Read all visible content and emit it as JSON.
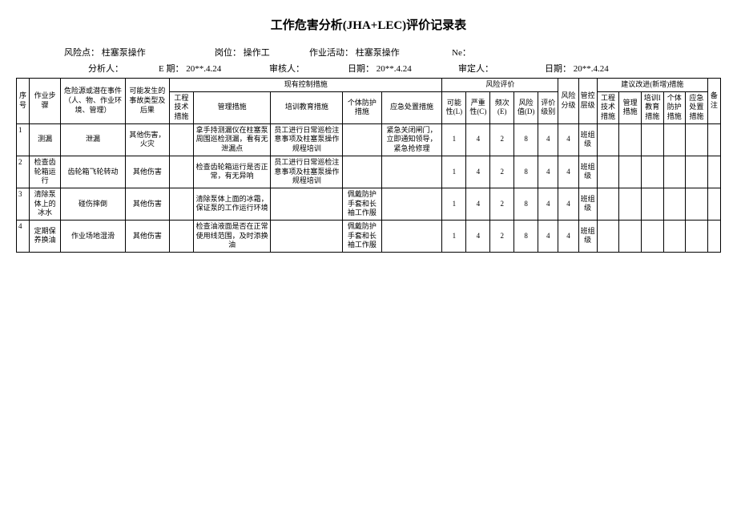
{
  "title": "工作危害分析(JHA+LEC)评价记录表",
  "meta": {
    "risk_point_label": "风险点：",
    "risk_point": "柱塞泵操作",
    "post_label": "岗位：",
    "post": "操作工",
    "activity_label": "作业活动：",
    "activity": "柱塞泵操作",
    "ne_label": "Ne：",
    "ne": "",
    "analyst_label": "分析人：",
    "analyst": "",
    "date_e_label": "E 期：",
    "date_e": "20**.4.24",
    "reviewer_label": "审核人：",
    "reviewer": "",
    "date1_label": "日期：",
    "date1": "20**.4.24",
    "approver_label": "审定人：",
    "approver": "",
    "date2_label": "日期：",
    "date2": "20**.4.24"
  },
  "headers": {
    "seq": "序号",
    "step": "作业步骤",
    "hazard": "危险源或潜在事件（人、物、作业环境、管理）",
    "accident": "可能发生的事故类型及后果",
    "existing": "现有控制措施",
    "eng": "工程技术措施",
    "mgmt": "管理措施",
    "train": "培训教育措施",
    "ppe": "个体防护措施",
    "emer": "应急处置措施",
    "risk_eval": "风险评价",
    "L": "可能性(L)",
    "C": "严重性(C)",
    "E": "频次(E)",
    "D": "风险值(D)",
    "grade": "评价级别",
    "risk_cls": "风险分级",
    "ctrl_lvl": "管控层级",
    "suggest": "建议改进(新增)措施",
    "s_eng": "工程技术措施",
    "s_mgmt": "管理措施",
    "s_train": "培训I教育措施",
    "s_ppe": "个体防护措施",
    "s_emer": "应急处置措施",
    "note": "备注"
  },
  "rows": [
    {
      "seq": "1",
      "step": "测漏",
      "hazard": "泄漏",
      "accident": "其他伤害，火灾",
      "eng": "",
      "mgmt": "拿手持测漏仪在柱塞泵周围巡检测漏，看有无泄漏点",
      "train": "员工进行日常巡检注意事项及柱塞泵操作规程培训",
      "ppe": "",
      "emer": "紧急关闭闸门，立即通知领导，紧急抢修理",
      "L": "1",
      "C": "4",
      "E": "2",
      "D": "8",
      "grade": "4",
      "risk_cls": "4",
      "ctrl": "班组级"
    },
    {
      "seq": "2",
      "step": "检查齿轮箱运行",
      "hazard": "齿轮箱飞轮转动",
      "accident": "其他伤害",
      "eng": "",
      "mgmt": "检查齿轮箱运行是否正常，有无异响",
      "train": "员工进行日常巡检注意事项及柱塞泵操作规程培训",
      "ppe": "",
      "emer": "",
      "L": "1",
      "C": "4",
      "E": "2",
      "D": "8",
      "grade": "4",
      "risk_cls": "4",
      "ctrl": "班组级"
    },
    {
      "seq": "3",
      "step": "清除泵体上的冰水",
      "hazard": "碰伤摔倒",
      "accident": "其他伤害",
      "eng": "",
      "mgmt": "清除泵体上面的冰霜，保证泵的工作运行环境",
      "train": "",
      "ppe": "佩戴防护手套和长袖工作服",
      "emer": "",
      "L": "1",
      "C": "4",
      "E": "2",
      "D": "8",
      "grade": "4",
      "risk_cls": "4",
      "ctrl": "班组级"
    },
    {
      "seq": "4",
      "step": "定期保养换油",
      "hazard": "作业场地湿滑",
      "accident": "其他伤害",
      "eng": "",
      "mgmt": "检查油液面是否在正常使用线范围，及时添换油",
      "train": "",
      "ppe": "佩戴防护手套和长袖工作服",
      "emer": "",
      "L": "1",
      "C": "4",
      "E": "2",
      "D": "8",
      "grade": "4",
      "risk_cls": "4",
      "ctrl": "班组级"
    }
  ]
}
